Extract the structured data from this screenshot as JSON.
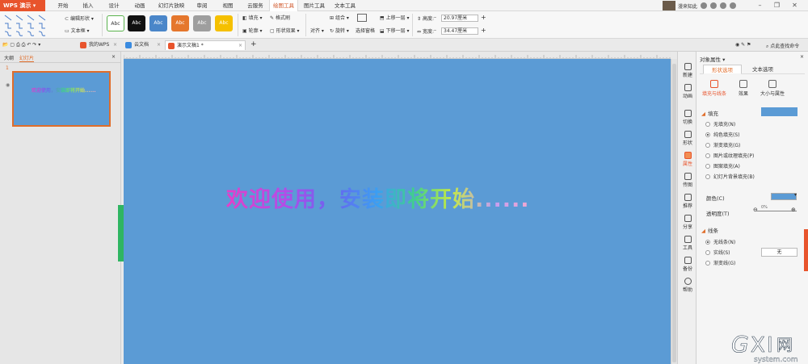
{
  "app": {
    "title": "WPS 演示"
  },
  "menu_tabs": [
    {
      "label": "开始"
    },
    {
      "label": "插入"
    },
    {
      "label": "设计"
    },
    {
      "label": "动画"
    },
    {
      "label": "幻灯片放映"
    },
    {
      "label": "审阅"
    },
    {
      "label": "视图"
    },
    {
      "label": "云服务"
    },
    {
      "label": "绘图工具"
    },
    {
      "label": "图片工具"
    },
    {
      "label": "文本工具"
    }
  ],
  "user": {
    "name": "漫来知此"
  },
  "ribbon": {
    "edit_shape": "编辑形状",
    "text_box": "文本框",
    "style_samples": [
      "Abc",
      "Abc",
      "Abc",
      "Abc",
      "Abc",
      "Abc"
    ],
    "fill": "填充",
    "format_painter": "格式刷",
    "outline": "轮廓",
    "shape_effects": "形状效果",
    "align": "对齐",
    "combine": "组合",
    "rotate": "旋转",
    "selection_pane": "选择窗格",
    "bring_forward": "上移一层",
    "send_backward": "下移一层",
    "height_label": "高度:",
    "height_value": "20.97厘米",
    "width_label": "宽度:",
    "width_value": "34.47厘米"
  },
  "doc_tabs": [
    {
      "label": "我的WPS"
    },
    {
      "label": "云文档"
    },
    {
      "label": "演示文稿1 *"
    }
  ],
  "search": {
    "label": "点此查找命令"
  },
  "outline_panel": {
    "tab_outline": "大纲",
    "tab_slides": "幻灯片",
    "slide_number": "1",
    "thumb_text": "欢迎使用，安装即将开始......"
  },
  "slide": {
    "title_text": "欢迎使用，安装即将开始......"
  },
  "sidebar": {
    "items": [
      {
        "label": "新建"
      },
      {
        "label": "动画"
      },
      {
        "label": "切换"
      },
      {
        "label": "形状"
      },
      {
        "label": "属性"
      },
      {
        "label": "传图"
      },
      {
        "label": "推荐"
      },
      {
        "label": "分享"
      },
      {
        "label": "工具"
      },
      {
        "label": "备份"
      },
      {
        "label": "帮助"
      }
    ]
  },
  "properties": {
    "title": "对象属性 ▾",
    "tab_shape": "形状选项",
    "tab_text": "文本选项",
    "sub_fill_line": "填充与线条",
    "sub_effects": "效果",
    "sub_size": "大小与属性",
    "fill_section": "填充",
    "fill_options": [
      {
        "label": "无填充(N)",
        "selected": false
      },
      {
        "label": "纯色填充(S)",
        "selected": true
      },
      {
        "label": "渐变填充(G)",
        "selected": false
      },
      {
        "label": "图片或纹理填充(P)",
        "selected": false
      },
      {
        "label": "图案填充(A)",
        "selected": false
      },
      {
        "label": "幻灯片背景填充(B)",
        "selected": false
      }
    ],
    "color_label": "颜色(C)",
    "transparency_label": "透明度(T)",
    "transparency_value": "0%",
    "line_section": "线条",
    "line_options": [
      {
        "label": "无线条(N)",
        "selected": true
      },
      {
        "label": "实线(S)",
        "selected": false
      },
      {
        "label": "渐变线(G)",
        "selected": false
      }
    ],
    "line_value": "无"
  },
  "watermark": {
    "text": "GXI网",
    "sub": "system.com"
  },
  "colors": {
    "accent": "#e8542c",
    "slide_bg": "#5b9bd5",
    "green": "#2fb562"
  }
}
